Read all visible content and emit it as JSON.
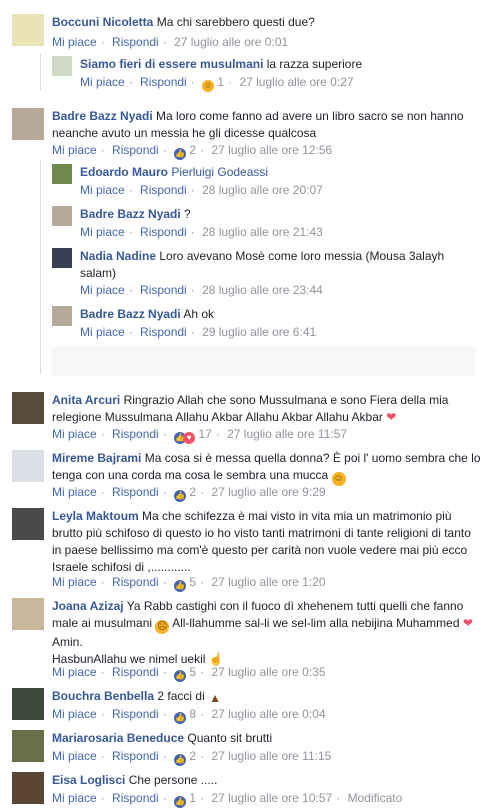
{
  "comments": [
    {
      "id": "c1",
      "avatar_color": "#eae3b8",
      "name": "Boccuni Nicoletta",
      "text": "Ma chi sarebbero questi due?",
      "like": "Mi piace",
      "reply": "Rispondi",
      "time": "27 luglio alle ore 0:01"
    },
    {
      "id": "r1",
      "avatar_color": "#cfd9c3",
      "name": "Siamo fieri di essere musulmani",
      "text": "la razza superiore",
      "like": "Mi piace",
      "reply": "Rispondi",
      "reaction_count": "1",
      "time": "27 luglio alle ore 0:27"
    },
    {
      "id": "c2",
      "avatar_color": "#b7a99a",
      "name": "Badre Bazz Nyadi",
      "text": "Ma loro come fanno ad avere un libro sacro se non hanno neanche avuto un messia he gli dicesse qualcosa",
      "like": "Mi piace",
      "reply": "Rispondi",
      "reaction_count": "2",
      "time": "27 luglio alle ore 12:56"
    },
    {
      "id": "r2",
      "avatar_color": "#6e8a4f",
      "name": "Edoardo Mauro",
      "text": "Pierluigi Godeassi",
      "like": "Mi piace",
      "reply": "Rispondi",
      "time": "28 luglio alle ore 20:07"
    },
    {
      "id": "r3",
      "avatar_color": "#b7a99a",
      "name": "Badre Bazz Nyadi",
      "text": "?",
      "like": "Mi piace",
      "reply": "Rispondi",
      "time": "28 luglio alle ore 21:43"
    },
    {
      "id": "r4",
      "avatar_color": "#3a3f55",
      "name": "Nadia Nadine",
      "text": "Loro avevano Mosè come loro messia (Mousa 3alayh salam)",
      "like": "Mi piace",
      "reply": "Rispondi",
      "time": "28 luglio alle ore 23:44"
    },
    {
      "id": "r5",
      "avatar_color": "#b7a99a",
      "name": "Badre Bazz Nyadi",
      "text": "Ah ok",
      "like": "Mi piace",
      "reply": "Rispondi",
      "time": "29 luglio alle ore 6:41"
    },
    {
      "id": "c3",
      "avatar_color": "#5a4a3a",
      "name": "Anita Arcuri",
      "text": "Ringrazio Allah che sono Mussulmana e sono Fiera della mia relegione Mussulmana Allahu Akbar Allahu Akbar Allahu Akbar",
      "like": "Mi piace",
      "reply": "Rispondi",
      "reaction_count": "17",
      "time": "27 luglio alle ore 11:57"
    },
    {
      "id": "c4",
      "avatar_color": "#dcdfe6",
      "name": "Mireme Bajrami",
      "text": "Ma cosa si è messa quella donna? È poi l' uomo sembra che lo tenga con una corda ma cosa le sembra una mucca",
      "like": "Mi piace",
      "reply": "Rispondi",
      "reaction_count": "2",
      "time": "27 luglio alle ore 9:29"
    },
    {
      "id": "c5",
      "avatar_color": "#4a4a4a",
      "name": "Leyla Maktoum",
      "text": "Ma che schifezza è mai visto in vita mia un matrimonio più brutto più schifoso di questo io ho visto tanti matrimoni di tante religioni di tanto in paese bellissimo ma com'è questo per carità non vuole vedere mai più ecco Israele schifosi di ,............",
      "like": "Mi piace",
      "reply": "Rispondi",
      "reaction_count": "5",
      "time": "27 luglio alle ore 1:20"
    },
    {
      "id": "c6",
      "avatar_color": "#c9b79c",
      "name": "Joana Azizaj",
      "text": "Ya Rabb castighi con il fuoco dì xhehenem tutti quelli che fanno male ai musulmani",
      "text2": "All-llahumme sal-li we sel-lim alla nebijina Muhammed",
      "text3": "Amin.",
      "text4": "HasbunAllahu we nimel uekil",
      "like": "Mi piace",
      "reply": "Rispondi",
      "reaction_count": "5",
      "time": "27 luglio alle ore 0:35"
    },
    {
      "id": "c7",
      "avatar_color": "#3b4a3a",
      "name": "Bouchra Benbella",
      "text": "2 facci di",
      "like": "Mi piace",
      "reply": "Rispondi",
      "reaction_count": "8",
      "time": "27 luglio alle ore 0:04"
    },
    {
      "id": "c8",
      "avatar_color": "#6a6f4a",
      "name": "Mariarosaria Beneduce",
      "text": "Quanto sit brutti",
      "like": "Mi piace",
      "reply": "Rispondi",
      "reaction_count": "2",
      "time": "27 luglio alle ore 11:15"
    },
    {
      "id": "c9",
      "avatar_color": "#5b4636",
      "name": "Eisa Loglisci",
      "text": "Che persone .....",
      "like": "Mi piace",
      "reply": "Rispondi",
      "reaction_count": "1",
      "time": "27 luglio alle ore 10:57",
      "edited": "Modificato"
    }
  ]
}
